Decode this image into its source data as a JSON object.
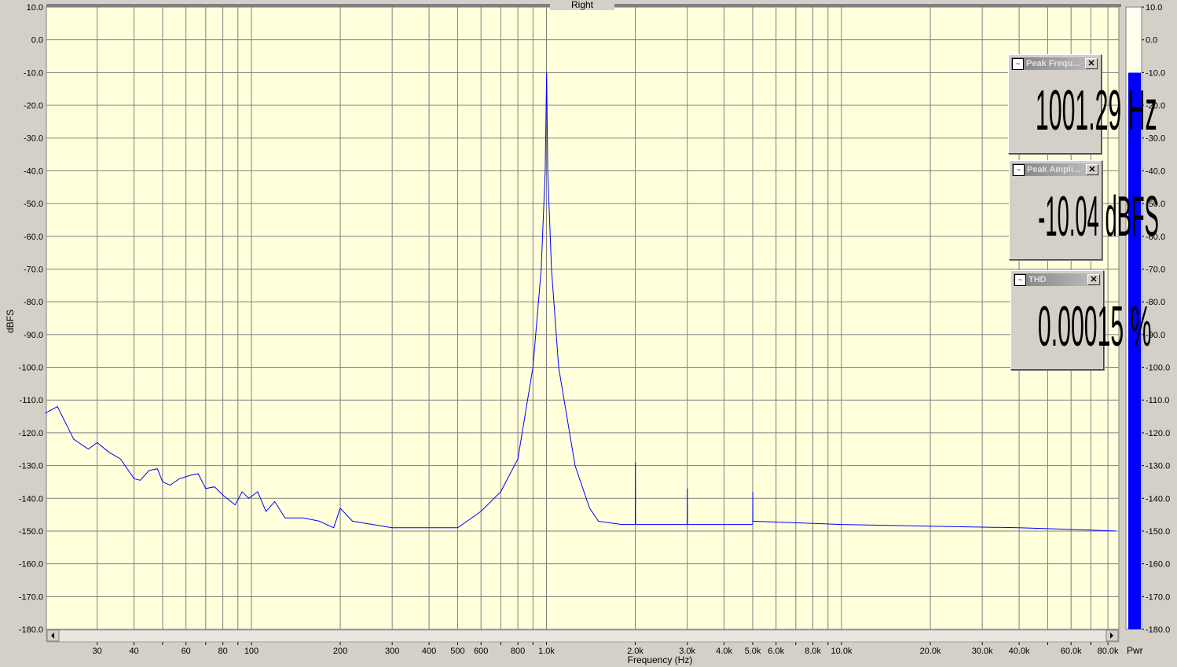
{
  "window": {
    "title": "Right"
  },
  "panels": [
    {
      "title": "Peak Frequ...",
      "value": "1001.29 Hz"
    },
    {
      "title": "Peak Ampli...",
      "value": "-10.04 dBFS"
    },
    {
      "title": "THD",
      "value": "0.00015 %"
    }
  ],
  "meter": {
    "label": "Pwr",
    "level_dbfs": -10.04,
    "range": [
      -180,
      10
    ]
  },
  "colors": {
    "plot_bg": "#ffffdc",
    "trace": "#0000ff",
    "meter": "#0000ff",
    "grid": "#808080"
  },
  "chart_data": {
    "type": "line",
    "title": "Right",
    "xlabel": "Frequency (Hz)",
    "ylabel": "dBFS",
    "xscale": "log",
    "xlim": [
      20,
      87000
    ],
    "ylim": [
      -180,
      10
    ],
    "grid": true,
    "yticks": [
      "10.0",
      "0.0",
      "-10.0",
      "-20.0",
      "-30.0",
      "-40.0",
      "-50.0",
      "-60.0",
      "-70.0",
      "-80.0",
      "-90.0",
      "-100.0",
      "-110.0",
      "-120.0",
      "-130.0",
      "-140.0",
      "-150.0",
      "-160.0",
      "-170.0",
      "-180.0"
    ],
    "ytick_values": [
      10,
      0,
      -10,
      -20,
      -30,
      -40,
      -50,
      -60,
      -70,
      -80,
      -90,
      -100,
      -110,
      -120,
      -130,
      -140,
      -150,
      -160,
      -170,
      -180
    ],
    "xticks": [
      {
        "v": 30,
        "t": "30"
      },
      {
        "v": 40,
        "t": "40"
      },
      {
        "v": 60,
        "t": "60"
      },
      {
        "v": 80,
        "t": "80"
      },
      {
        "v": 100,
        "t": "100"
      },
      {
        "v": 200,
        "t": "200"
      },
      {
        "v": 300,
        "t": "300"
      },
      {
        "v": 400,
        "t": "400"
      },
      {
        "v": 500,
        "t": "500"
      },
      {
        "v": 600,
        "t": "600"
      },
      {
        "v": 800,
        "t": "800"
      },
      {
        "v": 1000,
        "t": "1.0k"
      },
      {
        "v": 2000,
        "t": "2.0k"
      },
      {
        "v": 3000,
        "t": "3.0k"
      },
      {
        "v": 4000,
        "t": "4.0k"
      },
      {
        "v": 5000,
        "t": "5.0k"
      },
      {
        "v": 6000,
        "t": "6.0k"
      },
      {
        "v": 8000,
        "t": "8.0k"
      },
      {
        "v": 10000,
        "t": "10.0k"
      },
      {
        "v": 20000,
        "t": "20.0k"
      },
      {
        "v": 30000,
        "t": "30.0k"
      },
      {
        "v": 40000,
        "t": "40.0k"
      },
      {
        "v": 60000,
        "t": "60.0k"
      },
      {
        "v": 80000,
        "t": "80.0k"
      }
    ],
    "xgrid": [
      30,
      40,
      50,
      60,
      70,
      80,
      90,
      100,
      200,
      300,
      400,
      500,
      600,
      700,
      800,
      900,
      1000,
      2000,
      3000,
      4000,
      5000,
      6000,
      7000,
      8000,
      9000,
      10000,
      20000,
      30000,
      40000,
      50000,
      60000,
      70000,
      80000
    ],
    "series": [
      {
        "name": "Right",
        "points": [
          [
            20,
            -114
          ],
          [
            22,
            -112
          ],
          [
            25,
            -122
          ],
          [
            28,
            -125
          ],
          [
            30,
            -123
          ],
          [
            33,
            -126
          ],
          [
            36,
            -128
          ],
          [
            40,
            -134
          ],
          [
            42,
            -134.5
          ],
          [
            45,
            -131.5
          ],
          [
            48,
            -131
          ],
          [
            50,
            -135
          ],
          [
            53,
            -136
          ],
          [
            57,
            -134
          ],
          [
            62,
            -133
          ],
          [
            66,
            -132.5
          ],
          [
            70,
            -137
          ],
          [
            75,
            -136.5
          ],
          [
            80,
            -139
          ],
          [
            88,
            -142
          ],
          [
            93,
            -138
          ],
          [
            98,
            -140
          ],
          [
            105,
            -138
          ],
          [
            112,
            -144
          ],
          [
            120,
            -141
          ],
          [
            130,
            -146
          ],
          [
            150,
            -146
          ],
          [
            170,
            -147
          ],
          [
            190,
            -149
          ],
          [
            200,
            -143
          ],
          [
            220,
            -147
          ],
          [
            300,
            -149
          ],
          [
            400,
            -149
          ],
          [
            500,
            -149
          ],
          [
            600,
            -144
          ],
          [
            700,
            -138
          ],
          [
            800,
            -128
          ],
          [
            900,
            -100
          ],
          [
            960,
            -70
          ],
          [
            990,
            -40
          ],
          [
            1001,
            -10
          ],
          [
            1010,
            -40
          ],
          [
            1040,
            -70
          ],
          [
            1100,
            -100
          ],
          [
            1250,
            -130
          ],
          [
            1400,
            -143
          ],
          [
            1500,
            -147
          ],
          [
            1800,
            -148
          ],
          [
            2000,
            -148
          ],
          [
            2002,
            -129
          ],
          [
            2004,
            -148
          ],
          [
            3000,
            -148
          ],
          [
            3003,
            -137
          ],
          [
            3006,
            -148
          ],
          [
            5000,
            -148
          ],
          [
            5005,
            -138
          ],
          [
            5010,
            -147
          ],
          [
            10000,
            -148
          ],
          [
            20000,
            -148.5
          ],
          [
            40000,
            -149
          ],
          [
            60000,
            -149.5
          ],
          [
            85000,
            -150
          ]
        ]
      }
    ]
  }
}
